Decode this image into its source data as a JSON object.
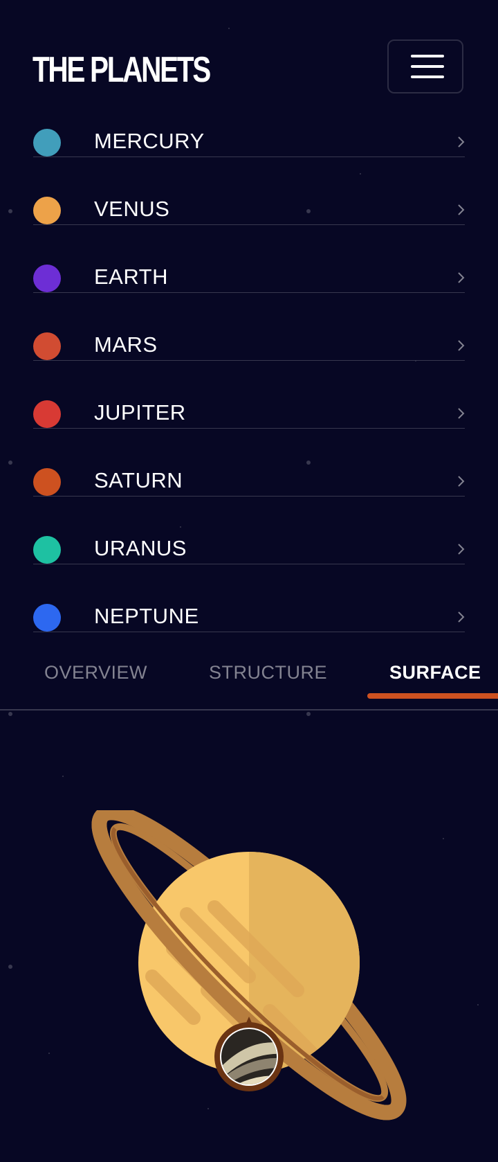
{
  "header": {
    "logo": "THE PLANETS",
    "menu_icon": "hamburger-icon"
  },
  "planets": [
    {
      "name": "MERCURY",
      "color": "#419EBB"
    },
    {
      "name": "VENUS",
      "color": "#EDA249"
    },
    {
      "name": "EARTH",
      "color": "#6D2ED5"
    },
    {
      "name": "MARS",
      "color": "#D14C32"
    },
    {
      "name": "JUPITER",
      "color": "#D83A34"
    },
    {
      "name": "SATURN",
      "color": "#CD5120"
    },
    {
      "name": "URANUS",
      "color": "#1EC1A2"
    },
    {
      "name": "NEPTUNE",
      "color": "#2D68F0"
    }
  ],
  "tabs": [
    {
      "label": "OVERVIEW",
      "active": false
    },
    {
      "label": "STRUCTURE",
      "active": false
    },
    {
      "label": "SURFACE",
      "active": true
    }
  ],
  "colors": {
    "background": "#070724",
    "divider": "#38384F",
    "accent": "#CD5120",
    "muted": "#838391"
  }
}
